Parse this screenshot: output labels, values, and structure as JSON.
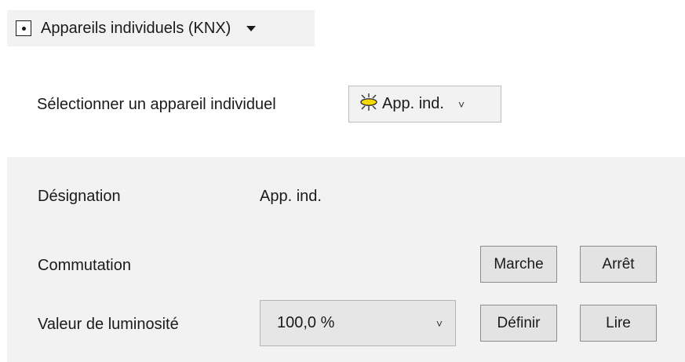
{
  "mode_selector": {
    "label": "Appareils individuels (KNX)",
    "icon": "radio-dot-icon",
    "caret": "dropdown-triangle-icon"
  },
  "device_select": {
    "label": "Sélectionner un appareil individuel",
    "value": "App. ind.",
    "icon": "lamp-icon",
    "icon_color": "#f5d800",
    "chevron": "˅"
  },
  "details": {
    "designation_label": "Désignation",
    "designation_value": "App. ind.",
    "commutation_label": "Commutation",
    "on_button": "Marche",
    "off_button": "Arrêt",
    "brightness_label": "Valeur de luminosité",
    "brightness_value": "100,0 %",
    "brightness_chevron": "˅",
    "set_button": "Définir",
    "read_button": "Lire"
  },
  "colors": {
    "panel_background": "#f2f2f2",
    "button_background": "#e3e3e3",
    "button_border": "#8c8c8c"
  }
}
